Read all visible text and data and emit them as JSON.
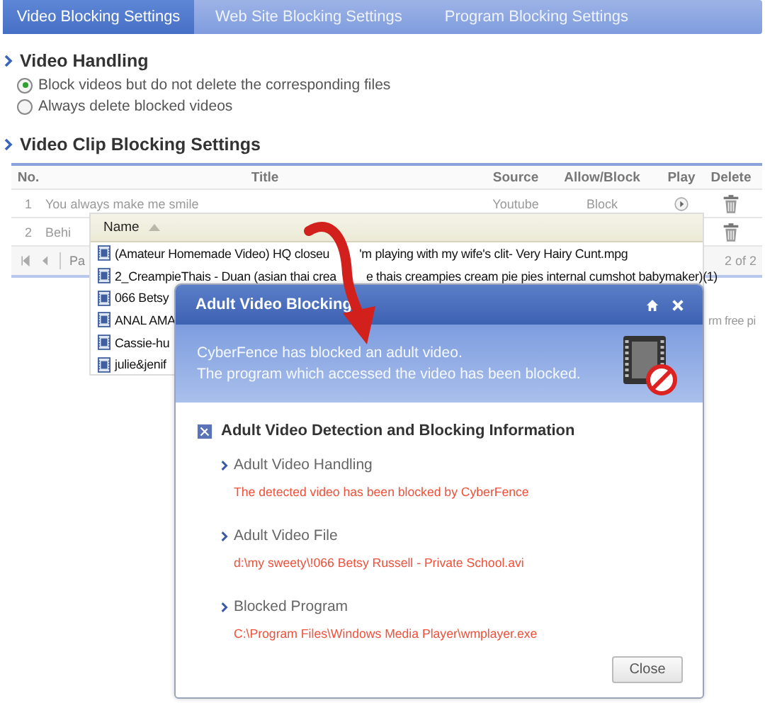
{
  "tabs": [
    {
      "label": "Video Blocking Settings",
      "selected": true
    },
    {
      "label": "Web Site Blocking Settings",
      "selected": false
    },
    {
      "label": "Program Blocking Settings",
      "selected": false
    }
  ],
  "video_handling": {
    "title": "Video Handling",
    "options": [
      {
        "label": "Block videos but do not delete the corresponding files",
        "selected": true
      },
      {
        "label": "Always delete blocked videos",
        "selected": false
      }
    ]
  },
  "clip_settings": {
    "title": "Video Clip Blocking Settings",
    "columns": [
      "No.",
      "Title",
      "Source",
      "Allow/Block",
      "Play",
      "Delete"
    ],
    "rows": [
      {
        "no": "1",
        "title": "You always make me smile",
        "source": "Youtube",
        "action": "Block"
      },
      {
        "no": "2",
        "title": "Behi"
      }
    ],
    "pager": {
      "page_label": "Pa",
      "range": "2 of 2"
    }
  },
  "file_list": {
    "column": "Name",
    "files": [
      {
        "name": "(Amateur Homemade Video) HQ closeu",
        "after": "'m playing with my wife's clit- Very Hairy Cunt.mpg"
      },
      {
        "name": "2_CreampieThais - Duan (asian thai crea",
        "after": "e thais creampies cream pie pies internal cumshot babymaker)(1)"
      },
      {
        "name": "066 Betsy"
      },
      {
        "name": "ANAL AMA",
        "tail": "rm free pi"
      },
      {
        "name": "Cassie-hu"
      },
      {
        "name": "julie&jenif"
      }
    ]
  },
  "dialog": {
    "title": "Adult Video Blocking",
    "message": [
      "CyberFence has blocked an adult video.",
      "The program which accessed the video has been blocked."
    ],
    "section_title": "Adult Video Detection and Blocking Information",
    "details": [
      {
        "label": "Adult Video Handling",
        "value": "The detected video has been blocked by CyberFence"
      },
      {
        "label": "Adult Video File",
        "value": "d:\\my sweety\\!066 Betsy Russell - Private School.avi"
      },
      {
        "label": "Blocked Program",
        "value": "C:\\Program Files\\Windows Media Player\\wmplayer.exe"
      }
    ],
    "close": "Close"
  }
}
